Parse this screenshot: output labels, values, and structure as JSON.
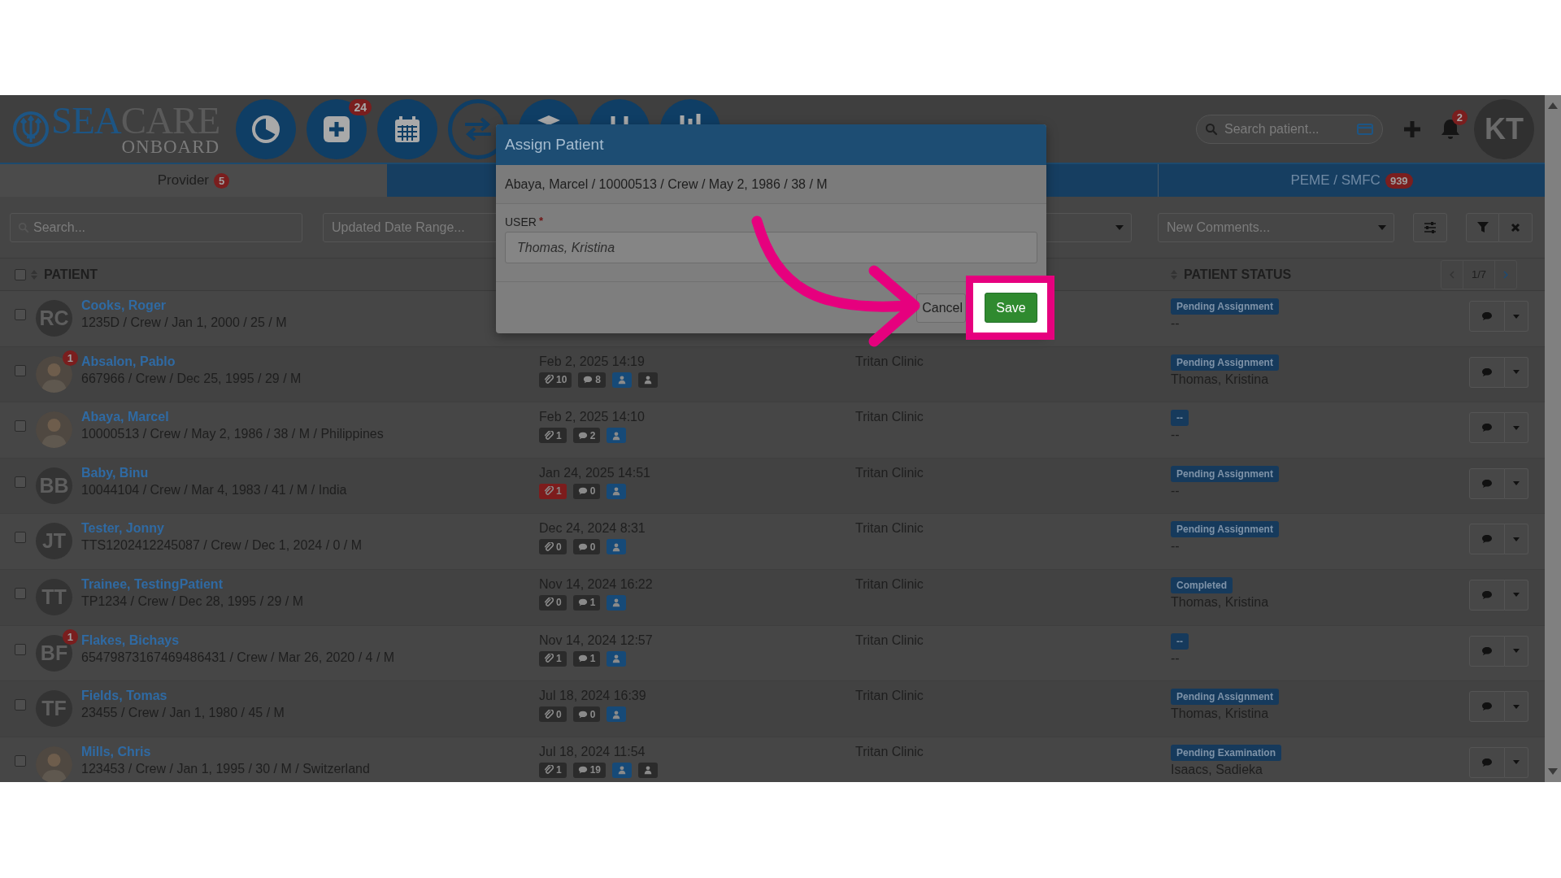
{
  "header": {
    "logo": {
      "wordmark_primary": "SEA",
      "wordmark_secondary": "CARE",
      "tagline": "ONBOARD"
    },
    "nav": [
      {
        "kind": "pie"
      },
      {
        "kind": "add",
        "badge": "24"
      },
      {
        "kind": "calendar"
      },
      {
        "kind": "transfer"
      },
      {
        "kind": "box"
      },
      {
        "kind": "swap"
      },
      {
        "kind": "chart"
      }
    ],
    "search": {
      "placeholder": "Search patient..."
    },
    "notifications": "2",
    "user_initials": "KT"
  },
  "tabs": [
    {
      "label": "Provider",
      "count": "5",
      "selected": true
    },
    {
      "label": "PEME / SMFC",
      "count": "939",
      "selected": false
    }
  ],
  "filters": {
    "search": {
      "placeholder": "Search..."
    },
    "date_range": {
      "placeholder": "Updated Date Range..."
    },
    "comments": {
      "placeholder": "New Comments..."
    }
  },
  "table": {
    "select_all_checked": false,
    "columns": {
      "patient": "PATIENT",
      "status": "PATIENT STATUS"
    },
    "pagination": "1/7",
    "rows": [
      {
        "name": "Cooks, Roger",
        "details": "1235D / Crew / Jan 1, 2000 / 25 / M",
        "avatar": {
          "kind": "initials",
          "text": "RC"
        },
        "checked": false,
        "status": "Pending Assignment",
        "assignee": "--"
      },
      {
        "name": "Absalon, Pablo",
        "details": "667966 / Crew / Dec 25, 1995 / 29 / M",
        "avatar": {
          "kind": "photo",
          "badge": "1"
        },
        "checked": false,
        "date": "Feb 2, 2025 14:19",
        "tags": [
          {
            "kind": "clip",
            "count": "10",
            "alert": false
          },
          {
            "kind": "comment",
            "count": "8",
            "alert": false
          },
          {
            "kind": "user",
            "assigned": true
          },
          {
            "kind": "user",
            "assigned": false
          }
        ],
        "clinic": "Tritan Clinic",
        "status": "Pending Assignment",
        "assignee": "Thomas, Kristina"
      },
      {
        "name": "Abaya, Marcel",
        "details": "10000513 / Crew / May 2, 1986 / 38 / M / Philippines",
        "avatar": {
          "kind": "photo"
        },
        "checked": false,
        "date": "Feb 2, 2025 14:10",
        "tags": [
          {
            "kind": "clip",
            "count": "1",
            "alert": false
          },
          {
            "kind": "comment",
            "count": "2",
            "alert": false
          },
          {
            "kind": "user",
            "assigned": true
          }
        ],
        "clinic": "Tritan Clinic",
        "status": "--",
        "assignee": "--"
      },
      {
        "name": "Baby, Binu",
        "details": "10044104 / Crew / Mar 4, 1983 / 41 / M / India",
        "avatar": {
          "kind": "initials",
          "text": "BB"
        },
        "checked": false,
        "date": "Jan 24, 2025 14:51",
        "tags": [
          {
            "kind": "clip",
            "count": "1",
            "alert": true
          },
          {
            "kind": "comment",
            "count": "0",
            "alert": false
          },
          {
            "kind": "user",
            "assigned": true
          }
        ],
        "clinic": "Tritan Clinic",
        "status": "Pending Assignment",
        "assignee": "--"
      },
      {
        "name": "Tester, Jonny",
        "details": "TTS1202412245087 / Crew / Dec 1, 2024 / 0 / M",
        "avatar": {
          "kind": "initials",
          "text": "JT"
        },
        "checked": false,
        "date": "Dec 24, 2024 8:31",
        "tags": [
          {
            "kind": "clip",
            "count": "0",
            "alert": false
          },
          {
            "kind": "comment",
            "count": "0",
            "alert": false
          },
          {
            "kind": "user",
            "assigned": true
          }
        ],
        "clinic": "Tritan Clinic",
        "status": "Pending Assignment",
        "assignee": "--"
      },
      {
        "name": "Trainee, TestingPatient",
        "details": "TP1234 / Crew / Dec 28, 1995 / 29 / M",
        "avatar": {
          "kind": "initials",
          "text": "TT"
        },
        "checked": false,
        "date": "Nov 14, 2024 16:22",
        "tags": [
          {
            "kind": "clip",
            "count": "0",
            "alert": false
          },
          {
            "kind": "comment",
            "count": "1",
            "alert": false
          },
          {
            "kind": "user",
            "assigned": true
          }
        ],
        "clinic": "Tritan Clinic",
        "status": "Completed",
        "assignee": "Thomas, Kristina"
      },
      {
        "name": "Flakes, Bichays",
        "details": "65479873167469486431 / Crew / Mar 26, 2020 / 4 / M",
        "avatar": {
          "kind": "initials",
          "text": "BF",
          "badge": "1"
        },
        "checked": false,
        "date": "Nov 14, 2024 12:57",
        "tags": [
          {
            "kind": "clip",
            "count": "1",
            "alert": false
          },
          {
            "kind": "comment",
            "count": "1",
            "alert": false
          },
          {
            "kind": "user",
            "assigned": true
          }
        ],
        "clinic": "Tritan Clinic",
        "status": "--",
        "assignee": "--"
      },
      {
        "name": "Fields, Tomas",
        "details": "23455 / Crew / Jan 1, 1980 / 45 / M",
        "avatar": {
          "kind": "initials",
          "text": "TF"
        },
        "checked": false,
        "date": "Jul 18, 2024 16:39",
        "tags": [
          {
            "kind": "clip",
            "count": "0",
            "alert": false
          },
          {
            "kind": "comment",
            "count": "0",
            "alert": false
          },
          {
            "kind": "user",
            "assigned": true
          }
        ],
        "clinic": "Tritan Clinic",
        "status": "Pending Assignment",
        "assignee": "Thomas, Kristina"
      },
      {
        "name": "Mills, Chris",
        "details": "123453 / Crew / Jan 1, 1995 / 30 / M / Switzerland",
        "avatar": {
          "kind": "photo"
        },
        "checked": false,
        "date": "Jul 18, 2024 11:54",
        "tags": [
          {
            "kind": "clip",
            "count": "1",
            "alert": false
          },
          {
            "kind": "comment",
            "count": "19",
            "alert": false
          },
          {
            "kind": "user",
            "assigned": true
          },
          {
            "kind": "user",
            "assigned": false
          }
        ],
        "clinic": "Tritan Clinic",
        "status": "Pending Examination",
        "assignee": "Isaacs, Sadieka"
      }
    ]
  },
  "modal": {
    "title": "Assign Patient",
    "patient_line": "Abaya, Marcel / 10000513 / Crew / May 2, 1986 / 38 / M",
    "field_label": "USER",
    "required_mark": "*",
    "value": "Thomas, Kristina",
    "cancel": "Cancel",
    "save": "Save"
  },
  "annotations": {
    "save_highlight": true,
    "pointer_arrow": true
  }
}
